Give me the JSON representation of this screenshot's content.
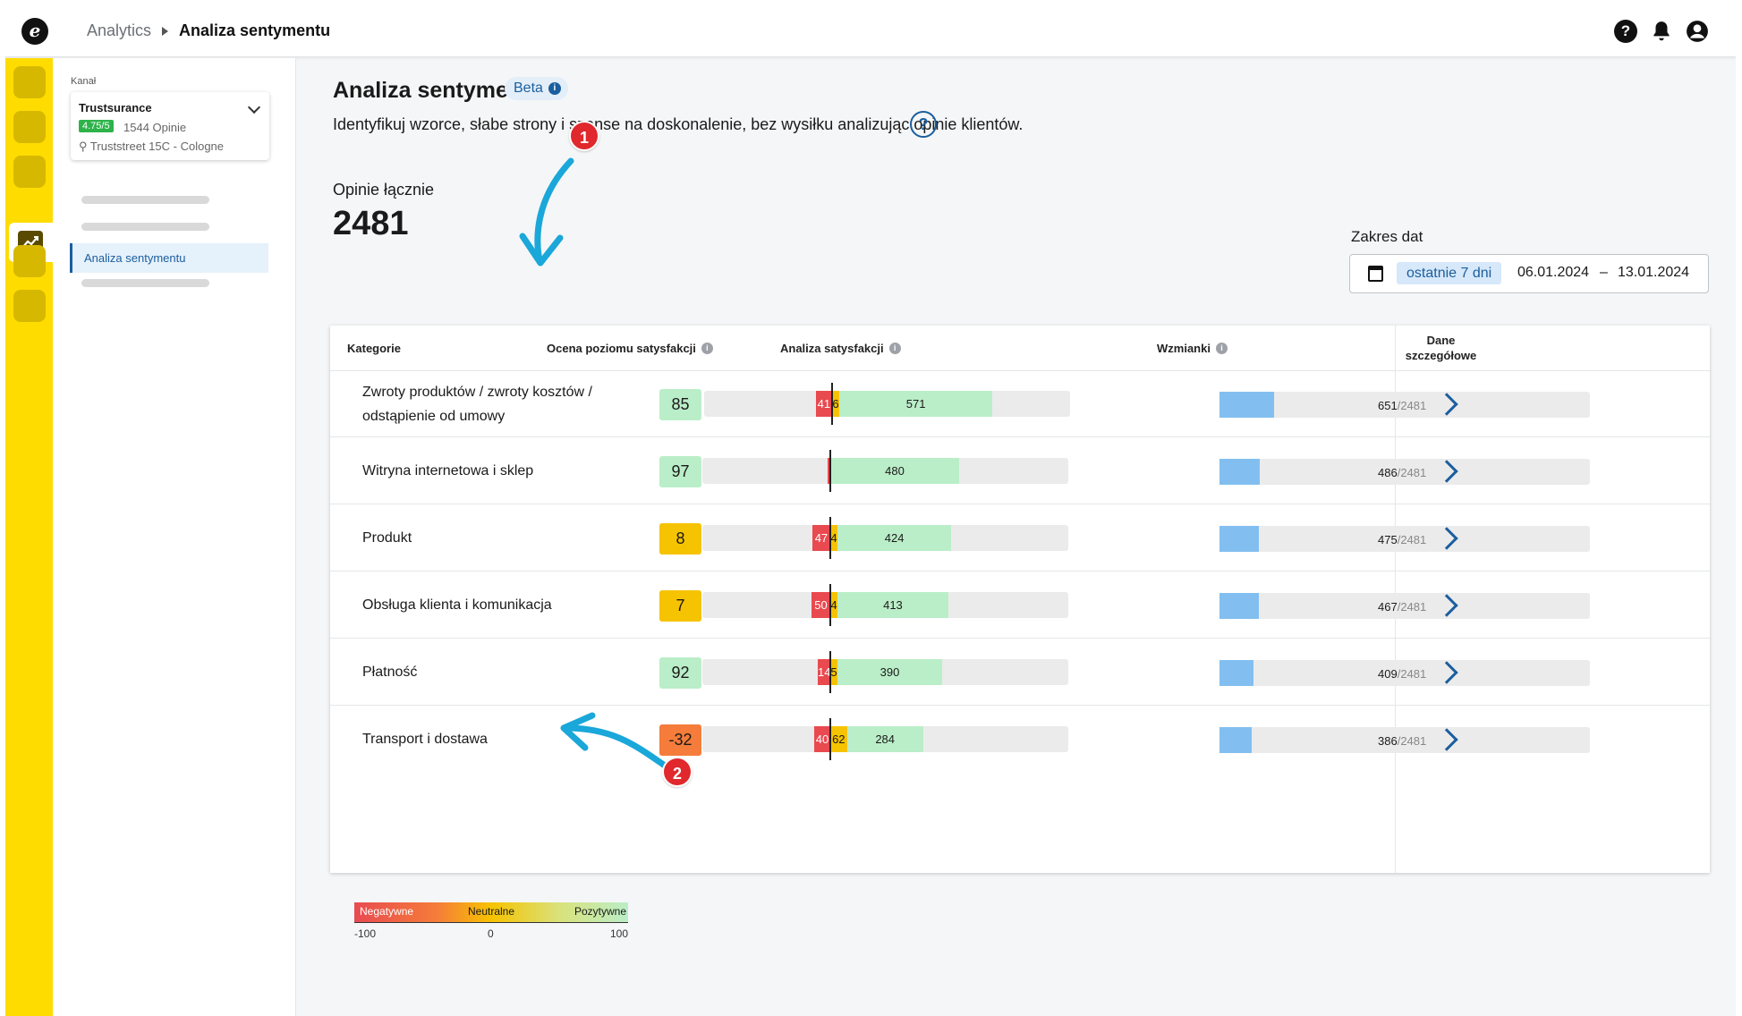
{
  "header": {
    "breadcrumb_parent": "Analytics",
    "breadcrumb_current": "Analiza sentymentu",
    "help_label": "?"
  },
  "sidebar": {
    "kanal_label": "Kanał",
    "channel": {
      "name": "Trustsurance",
      "rating": "4.75/5",
      "opinions": "1544 Opinie",
      "address": "Truststreet 15C - Cologne"
    },
    "active_item": "Analiza sentymentu"
  },
  "page": {
    "title": "Analiza sentymentu",
    "beta": "Beta",
    "subtitle": "Identyfikuj wzorce, słabe strony i szanse na doskonalenie, bez wysiłku analizując opinie klientów.",
    "help": "?",
    "total_label": "Opinie łącznie",
    "total_value": "2481",
    "date_label": "Zakres dat",
    "date_preset": "ostatnie 7 dni",
    "date_from": "06.01.2024",
    "date_sep": "–",
    "date_to": "13.01.2024"
  },
  "table": {
    "headers": {
      "category": "Kategorie",
      "score": "Ocena poziomu satysfakcji",
      "analysis": "Analiza satysfakcji",
      "mentions": "Wzmianki",
      "detail_1": "Dane",
      "detail_2": "szczegółowe"
    },
    "total": 2481,
    "rows": [
      {
        "category": "Zwroty produktów / zwroty kosztów / odstąpienie od umowy",
        "score": "85",
        "score_color": "#baeec8",
        "negative": "41",
        "neutral": "6",
        "positive": "571",
        "mentions": "651",
        "mentions_total": "/2481"
      },
      {
        "category": "Witryna internetowa i sklep",
        "score": "97",
        "score_color": "#baeec8",
        "negative": "",
        "neutral": "",
        "positive": "480",
        "mentions": "486",
        "mentions_total": "/2481"
      },
      {
        "category": "Produkt",
        "score": "8",
        "score_color": "#f6c300",
        "negative": "47",
        "neutral": "4",
        "positive": "424",
        "mentions": "475",
        "mentions_total": "/2481"
      },
      {
        "category": "Obsługa klienta i komunikacja",
        "score": "7",
        "score_color": "#f6c300",
        "negative": "50",
        "neutral": "4",
        "positive": "413",
        "mentions": "467",
        "mentions_total": "/2481"
      },
      {
        "category": "Płatność",
        "score": "92",
        "score_color": "#baeec8",
        "negative": "14",
        "neutral": "5",
        "positive": "390",
        "mentions": "409",
        "mentions_total": "/2481"
      },
      {
        "category": "Transport i dostawa",
        "score": "-32",
        "score_color": "#f57c3a",
        "negative": "40",
        "neutral": "62",
        "positive": "284",
        "mentions": "386",
        "mentions_total": "/2481"
      }
    ]
  },
  "legend": {
    "negative": "Negatywne",
    "neutral": "Neutralne",
    "positive": "Pozytywne",
    "min": "-100",
    "mid": "0",
    "max": "100"
  },
  "annotations": [
    "1",
    "2"
  ],
  "colors": {
    "accent": "#1b5e9e",
    "rail": "#ffdc00",
    "negative": "#e84a50",
    "neutral": "#f6c300",
    "positive": "#baeec8",
    "mentions": "#82bff0",
    "annotation": "#e0282d",
    "arrow": "#1aa7d9"
  }
}
